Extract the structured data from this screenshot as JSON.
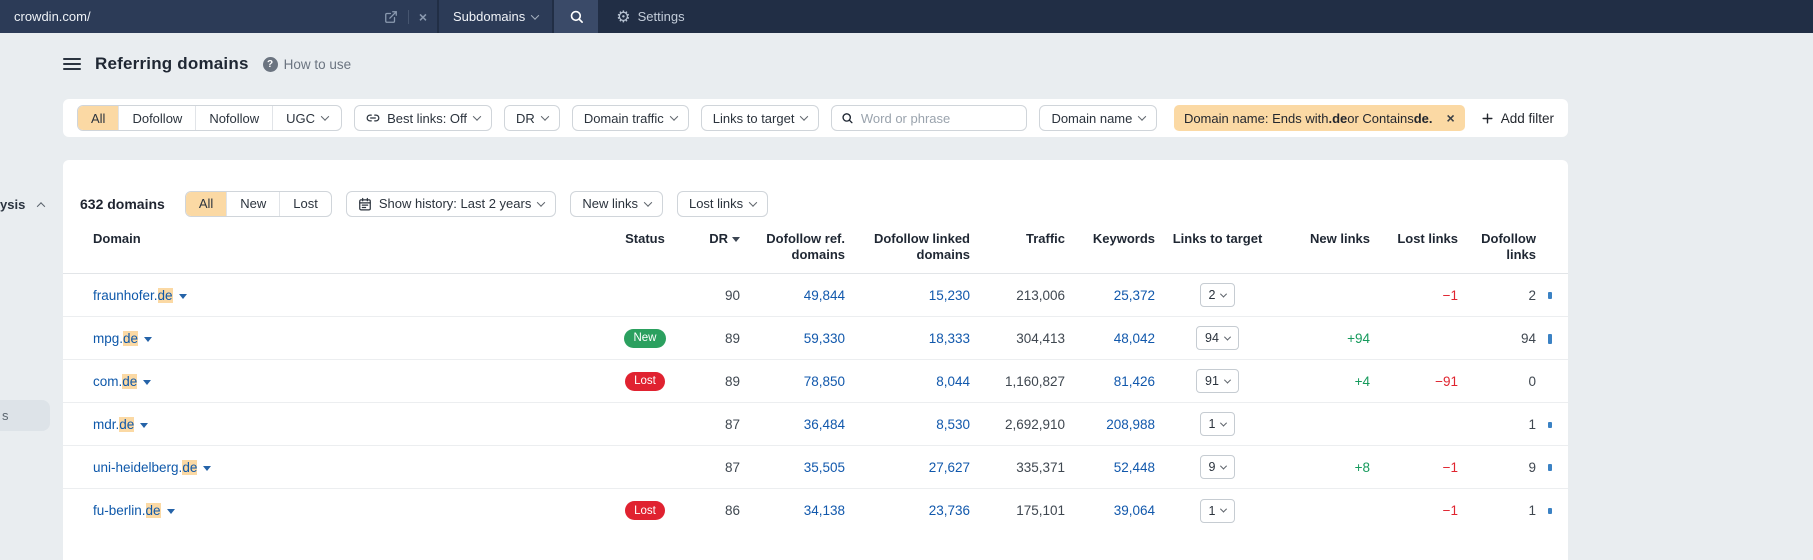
{
  "topbar": {
    "target_value": "crowdin.com/",
    "mode_label": "Subdomains",
    "settings_label": "Settings"
  },
  "header": {
    "title": "Referring domains",
    "help_label": "How to use"
  },
  "sidebar": {
    "partial_section": "ysis",
    "partial_item": "s"
  },
  "filters": {
    "segments": [
      "All",
      "Dofollow",
      "Nofollow",
      "UGC"
    ],
    "active_segment": "All",
    "best_links_label": "Best links: Off",
    "dr_label": "DR",
    "domain_traffic_label": "Domain traffic",
    "links_to_target_label": "Links to target",
    "search_placeholder": "Word or phrase",
    "domain_name_label": "Domain name",
    "active_filter": {
      "prefix": "Domain name: Ends with ",
      "bold1": ".de",
      "middle": " or Contains ",
      "bold2": "de."
    },
    "add_filter_label": "Add filter"
  },
  "toolbar": {
    "count": "632 domains",
    "segments": [
      "All",
      "New",
      "Lost"
    ],
    "active_segment": "All",
    "show_history_label": "Show history: Last 2 years",
    "new_links_label": "New links",
    "lost_links_label": "Lost links"
  },
  "table": {
    "columns": [
      "Domain",
      "Status",
      "DR",
      "Dofollow ref. domains",
      "Dofollow linked domains",
      "Traffic",
      "Keywords",
      "Links to target",
      "New links",
      "Lost links",
      "Dofollow links"
    ],
    "rows": [
      {
        "domain_prefix": "fraunhofer.",
        "domain_match": "de",
        "status": "",
        "dr": "90",
        "dofollow_ref": "49,844",
        "dofollow_linked": "15,230",
        "traffic": "213,006",
        "keywords": "25,372",
        "links_to_target": "2",
        "new_links": "",
        "lost_links": "−1",
        "dofollow_links": "2",
        "bar": 7
      },
      {
        "domain_prefix": "mpg.",
        "domain_match": "de",
        "status": "New",
        "dr": "89",
        "dofollow_ref": "59,330",
        "dofollow_linked": "18,333",
        "traffic": "304,413",
        "keywords": "48,042",
        "links_to_target": "94",
        "new_links": "+94",
        "lost_links": "",
        "dofollow_links": "94",
        "bar": 10
      },
      {
        "domain_prefix": "com.",
        "domain_match": "de",
        "status": "Lost",
        "dr": "89",
        "dofollow_ref": "78,850",
        "dofollow_linked": "8,044",
        "traffic": "1,160,827",
        "keywords": "81,426",
        "links_to_target": "91",
        "new_links": "+4",
        "lost_links": "−91",
        "dofollow_links": "0",
        "bar": 0
      },
      {
        "domain_prefix": "mdr.",
        "domain_match": "de",
        "status": "",
        "dr": "87",
        "dofollow_ref": "36,484",
        "dofollow_linked": "8,530",
        "traffic": "2,692,910",
        "keywords": "208,988",
        "links_to_target": "1",
        "new_links": "",
        "lost_links": "",
        "dofollow_links": "1",
        "bar": 6
      },
      {
        "domain_prefix": "uni-heidelberg.",
        "domain_match": "de",
        "status": "",
        "dr": "87",
        "dofollow_ref": "35,505",
        "dofollow_linked": "27,627",
        "traffic": "335,371",
        "keywords": "52,448",
        "links_to_target": "9",
        "new_links": "+8",
        "lost_links": "−1",
        "dofollow_links": "9",
        "bar": 7
      },
      {
        "domain_prefix": "fu-berlin.",
        "domain_match": "de",
        "status": "Lost",
        "dr": "86",
        "dofollow_ref": "34,138",
        "dofollow_linked": "23,736",
        "traffic": "175,101",
        "keywords": "39,064",
        "links_to_target": "1",
        "new_links": "",
        "lost_links": "−1",
        "dofollow_links": "1",
        "bar": 6
      }
    ]
  },
  "colors": {
    "topbar_bg": "#212e45",
    "accent_tan": "#fbd9a4",
    "link_blue": "#1158ac",
    "badge_new": "#2ba05f",
    "badge_lost": "#e02230",
    "positive_green": "#169a5c",
    "negative_red": "#e0242f"
  }
}
